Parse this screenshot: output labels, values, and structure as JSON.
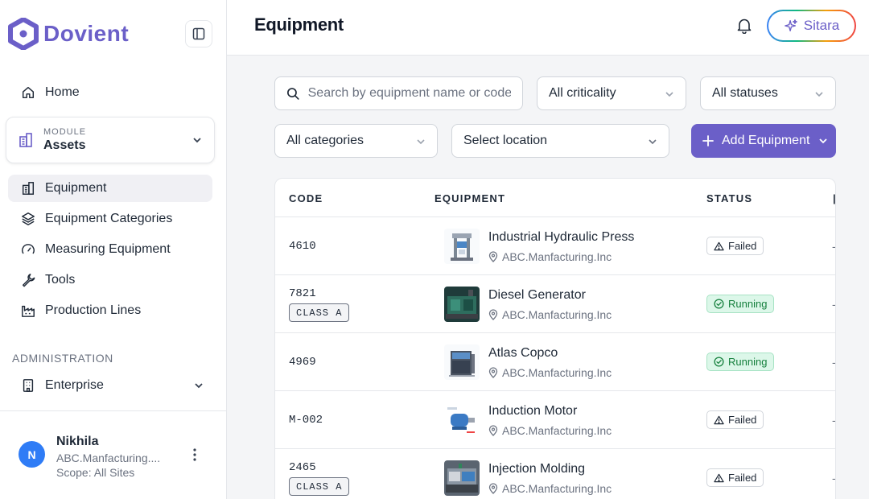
{
  "brand": {
    "name": "Dovient",
    "color": "#6b5fc8"
  },
  "sidebar": {
    "home": "Home",
    "module": {
      "label": "MODULE",
      "value": "Assets"
    },
    "items": [
      {
        "label": "Equipment",
        "icon": "building-icon",
        "active": true
      },
      {
        "label": "Equipment Categories",
        "icon": "layers-icon"
      },
      {
        "label": "Measuring Equipment",
        "icon": "gauge-icon"
      },
      {
        "label": "Tools",
        "icon": "wrench-icon"
      },
      {
        "label": "Production Lines",
        "icon": "factory-icon"
      }
    ],
    "admin_title": "ADMINISTRATION",
    "enterprise": "Enterprise",
    "user": {
      "initial": "N",
      "name": "Nikhila",
      "org": "ABC.Manfacturing....",
      "scope": "Scope: All Sites"
    }
  },
  "header": {
    "title": "Equipment",
    "assistant": "Sitara"
  },
  "filters": {
    "search_placeholder": "Search by equipment name or code",
    "criticality": "All criticality",
    "statuses": "All statuses",
    "categories": "All categories",
    "location": "Select location",
    "add_label": "Add Equipment"
  },
  "table": {
    "columns": [
      "CODE",
      "EQUIPMENT",
      "STATUS"
    ],
    "rows": [
      {
        "code": "4610",
        "badge": "",
        "name": "Industrial Hydraulic Press",
        "location": "ABC.Manfacturing.Inc",
        "status": "Failed",
        "trail": "-"
      },
      {
        "code": "7821",
        "badge": "CLASS A",
        "name": "Diesel Generator",
        "location": "ABC.Manfacturing.Inc",
        "status": "Running",
        "trail": "-"
      },
      {
        "code": "4969",
        "badge": "",
        "name": "Atlas Copco",
        "location": "ABC.Manfacturing.Inc",
        "status": "Running",
        "trail": "-"
      },
      {
        "code": "M-002",
        "badge": "",
        "name": "Induction Motor",
        "location": "ABC.Manfacturing.Inc",
        "status": "Failed",
        "trail": "-"
      },
      {
        "code": "2465",
        "badge": "CLASS A",
        "name": "Injection Molding",
        "location": "ABC.Manfacturing.Inc",
        "status": "Failed",
        "trail": "-"
      }
    ]
  },
  "colors": {
    "accent": "#6b5fc8",
    "running_bg": "#dcf7e9",
    "running_text": "#15803d",
    "avatar": "#2f7cf6"
  }
}
